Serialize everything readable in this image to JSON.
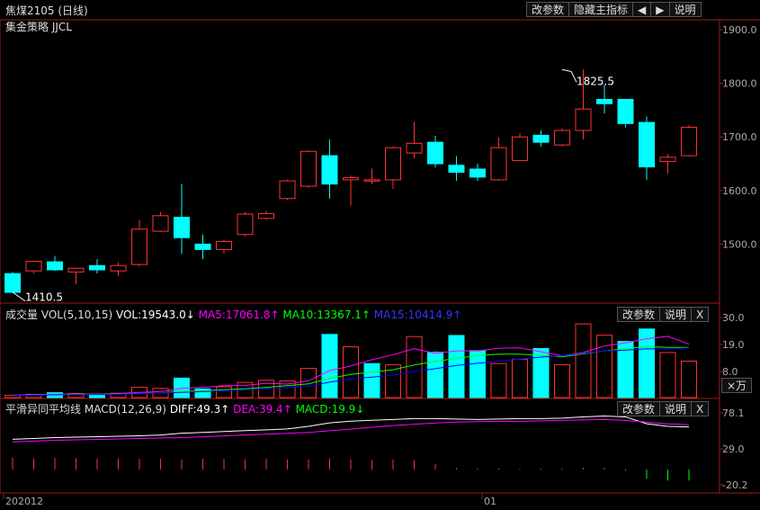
{
  "title": "焦煤2105 (日线)",
  "strategy": "集金策略 JJCL",
  "toolbar": {
    "params": "改参数",
    "hide_indicator": "隐藏主指标",
    "left_arrow": "left-arrow-icon",
    "right_arrow": "right-arrow-icon",
    "help": "说明"
  },
  "vol_header": {
    "name": "成交量",
    "spec": "VOL(5,10,15)",
    "vol": "VOL:19543.0↓",
    "ma5": "MA5:17061.8↑",
    "ma10": "MA10:13367.1↑",
    "ma15": "MA15:10414.9↑"
  },
  "vol_toolbar": {
    "params": "改参数",
    "help": "说明",
    "close": "X"
  },
  "vol_unit": "×万",
  "macd_header": {
    "name": "平滑异同平均线",
    "spec": "MACD(12,26,9)",
    "diff": "DIFF:49.3↑",
    "dea": "DEA:39.4↑",
    "macd": "MACD:19.9↓"
  },
  "macd_toolbar": {
    "params": "改参数",
    "help": "说明",
    "close": "X"
  },
  "date_labels": [
    "202012",
    "01"
  ],
  "colors": {
    "up": "#ff3232",
    "down": "#00ffff",
    "ma5": "#ff00ff",
    "ma10": "#00ff00",
    "ma15": "#0000ff",
    "diff": "#ffffff",
    "dea": "#ff00ff",
    "axis": "#9e1b1b"
  },
  "chart_data": [
    {
      "type": "candlestick",
      "price_axis": {
        "ticks": [
          "1900.0",
          "1800.0",
          "1700.0",
          "1600.0",
          "1500.0"
        ],
        "range": [
          1410,
          1935
        ]
      },
      "annotations": [
        {
          "label": "1410.5",
          "candle": 0,
          "value": 1410.5
        },
        {
          "label": "1825.5",
          "candle": 26,
          "value": 1825.5
        }
      ],
      "candles": [
        {
          "o": 1445,
          "h": 1448,
          "l": 1410.5,
          "c": 1410
        },
        {
          "o": 1450,
          "h": 1468,
          "l": 1445,
          "c": 1468
        },
        {
          "o": 1467,
          "h": 1478,
          "l": 1450,
          "c": 1452
        },
        {
          "o": 1448,
          "h": 1456,
          "l": 1425,
          "c": 1455
        },
        {
          "o": 1460,
          "h": 1472,
          "l": 1445,
          "c": 1452
        },
        {
          "o": 1450,
          "h": 1466,
          "l": 1440,
          "c": 1460
        },
        {
          "o": 1462,
          "h": 1545,
          "l": 1458,
          "c": 1528
        },
        {
          "o": 1524,
          "h": 1560,
          "l": 1522,
          "c": 1553
        },
        {
          "o": 1550,
          "h": 1612,
          "l": 1482,
          "c": 1512
        },
        {
          "o": 1500,
          "h": 1518,
          "l": 1472,
          "c": 1490
        },
        {
          "o": 1490,
          "h": 1508,
          "l": 1482,
          "c": 1505
        },
        {
          "o": 1518,
          "h": 1560,
          "l": 1514,
          "c": 1556
        },
        {
          "o": 1548,
          "h": 1562,
          "l": 1545,
          "c": 1557
        },
        {
          "o": 1585,
          "h": 1620,
          "l": 1582,
          "c": 1618
        },
        {
          "o": 1608,
          "h": 1675,
          "l": 1605,
          "c": 1673
        },
        {
          "o": 1665,
          "h": 1695,
          "l": 1585,
          "c": 1612
        },
        {
          "o": 1620,
          "h": 1628,
          "l": 1572,
          "c": 1624
        },
        {
          "o": 1618,
          "h": 1641,
          "l": 1612,
          "c": 1620
        },
        {
          "o": 1620,
          "h": 1682,
          "l": 1603,
          "c": 1680
        },
        {
          "o": 1670,
          "h": 1728,
          "l": 1660,
          "c": 1688
        },
        {
          "o": 1690,
          "h": 1702,
          "l": 1643,
          "c": 1650
        },
        {
          "o": 1647,
          "h": 1664,
          "l": 1618,
          "c": 1634
        },
        {
          "o": 1640,
          "h": 1650,
          "l": 1618,
          "c": 1625
        },
        {
          "o": 1620,
          "h": 1699,
          "l": 1618,
          "c": 1680
        },
        {
          "o": 1656,
          "h": 1707,
          "l": 1655,
          "c": 1700
        },
        {
          "o": 1703,
          "h": 1712,
          "l": 1682,
          "c": 1690
        },
        {
          "o": 1685,
          "h": 1716,
          "l": 1682,
          "c": 1712
        },
        {
          "o": 1712,
          "h": 1825.5,
          "l": 1695,
          "c": 1752
        },
        {
          "o": 1770,
          "h": 1797,
          "l": 1744,
          "c": 1762
        },
        {
          "o": 1770,
          "h": 1770,
          "l": 1718,
          "c": 1725
        },
        {
          "o": 1727,
          "h": 1738,
          "l": 1620,
          "c": 1644
        },
        {
          "o": 1654,
          "h": 1668,
          "l": 1632,
          "c": 1662
        },
        {
          "o": 1665,
          "h": 1722,
          "l": 1663,
          "c": 1718
        }
      ]
    },
    {
      "type": "bar",
      "name": "VOL(5,10,15)",
      "axis": {
        "ticks": [
          "30.0",
          "19.0",
          "8.0"
        ],
        "range": [
          0,
          30
        ]
      },
      "values": [
        0.8,
        1.2,
        1.8,
        1.5,
        1.2,
        1.6,
        3.8,
        3.4,
        7.2,
        3.2,
        4.0,
        5.6,
        6.4,
        6.2,
        10.8,
        23.4,
        18.8,
        12.6,
        12.1,
        22.6,
        16.8,
        23.0,
        17.4,
        12.6,
        14.2,
        18.2,
        12.2,
        27.3,
        23.1,
        20.8,
        25.4,
        16.7,
        13.5
      ],
      "up": [
        true,
        true,
        false,
        true,
        false,
        true,
        true,
        true,
        false,
        false,
        true,
        true,
        true,
        true,
        true,
        false,
        true,
        false,
        true,
        true,
        false,
        false,
        false,
        true,
        true,
        false,
        true,
        true,
        true,
        false,
        false,
        true,
        true
      ],
      "ma5": [
        0.9,
        1.1,
        1.3,
        1.3,
        1.3,
        1.5,
        1.9,
        2.2,
        3.4,
        3.8,
        4.4,
        4.5,
        5.3,
        5.0,
        6.2,
        10.0,
        11.7,
        14.0,
        15.9,
        18.1,
        16.4,
        17.3,
        17.3,
        18.3,
        18.4,
        17.0,
        15.5,
        16.7,
        19.1,
        20.3,
        21.8,
        22.7,
        19.8
      ],
      "ma10": [
        0.8,
        1.0,
        1.1,
        1.2,
        1.2,
        1.3,
        1.5,
        1.7,
        2.3,
        2.5,
        2.9,
        3.3,
        3.8,
        4.4,
        5.1,
        7.1,
        8.6,
        9.4,
        10.3,
        12.1,
        13.4,
        14.5,
        15.6,
        16.1,
        16.1,
        15.6,
        15.1,
        16.2,
        17.3,
        18.1,
        18.9,
        18.6,
        18.6
      ],
      "ma15": [
        0.7,
        0.9,
        1.0,
        1.1,
        1.1,
        1.2,
        1.4,
        1.7,
        1.9,
        2.2,
        2.5,
        2.9,
        3.3,
        3.7,
        4.2,
        5.7,
        6.9,
        7.6,
        8.3,
        9.7,
        10.7,
        11.9,
        12.7,
        13.5,
        14.3,
        15.0,
        15.5,
        16.4,
        17.3,
        17.6,
        18.1,
        18.0,
        18.4
      ]
    },
    {
      "type": "bar",
      "name": "MACD(12,26,9)",
      "axis": {
        "ticks": [
          "78.1",
          "29.0",
          "-20.2"
        ],
        "range": [
          -20.2,
          78.1
        ]
      },
      "diff": [
        35,
        36,
        37,
        37.5,
        38,
        38.5,
        39,
        40,
        42,
        43,
        44,
        45,
        46,
        47,
        50,
        54,
        56,
        57,
        58,
        59,
        59,
        58.5,
        58,
        58.5,
        59,
        59,
        59.5,
        61,
        62,
        61,
        53,
        50,
        49.3
      ],
      "dea": [
        34,
        35,
        36,
        36.5,
        37,
        37.5,
        38,
        38.5,
        39,
        40,
        41,
        42,
        43,
        44,
        45,
        47,
        49,
        51,
        53,
        54.5,
        56,
        57,
        57.5,
        58,
        58,
        58.5,
        59,
        59.5,
        60,
        59,
        57,
        55,
        54
      ],
      "macd": [
        13.0,
        12.0,
        12.5,
        12.2,
        12.0,
        12.0,
        11.5,
        11.5,
        11.0,
        11.5,
        11.5,
        11.0,
        12.0,
        11.0,
        11.0,
        12.0,
        11.0,
        10.0,
        11.0,
        10.0,
        6.0,
        2.0,
        1.5,
        1.5,
        1.0,
        1.0,
        1.0,
        2.0,
        2.0,
        -1.0,
        -10.0,
        -12.0,
        -12.0
      ]
    }
  ]
}
